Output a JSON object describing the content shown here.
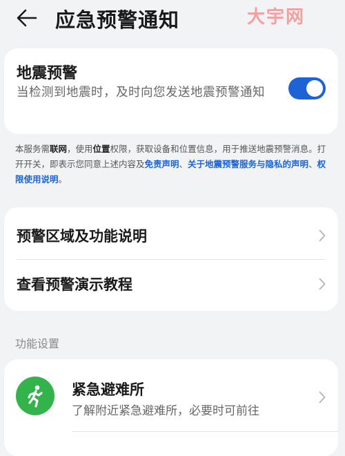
{
  "header": {
    "title": "应急预警通知",
    "watermark": "大宇网"
  },
  "quake": {
    "title": "地震预警",
    "description": "当检测到地震时，及时向您发送地震预警通知",
    "enabled": true,
    "accent_color": "#1e63d6"
  },
  "notice": {
    "p1": "本服务需",
    "b1": "联网",
    "p2": "，使用",
    "b2": "位置",
    "p3": "权限，获取设备和位置信息，用于推送地震预警消息。打开开关，即表示您同意上述内容及",
    "link1": "免责声明",
    "sep": "、",
    "link2": "关于地震预警服务与隐私的声明",
    "link3": "权限使用说明",
    "end": "。"
  },
  "menu": {
    "items": [
      {
        "label": "预警区域及功能说明",
        "icon": "chevron-right-icon"
      },
      {
        "label": "查看预警演示教程",
        "icon": "chevron-right-icon"
      }
    ]
  },
  "section": {
    "title": "功能设置"
  },
  "feature": {
    "title": "紧急避难所",
    "description": "了解附近紧急避难所，必要时可前往",
    "icon": "running-person-icon",
    "icon_color": "#34b24c"
  }
}
